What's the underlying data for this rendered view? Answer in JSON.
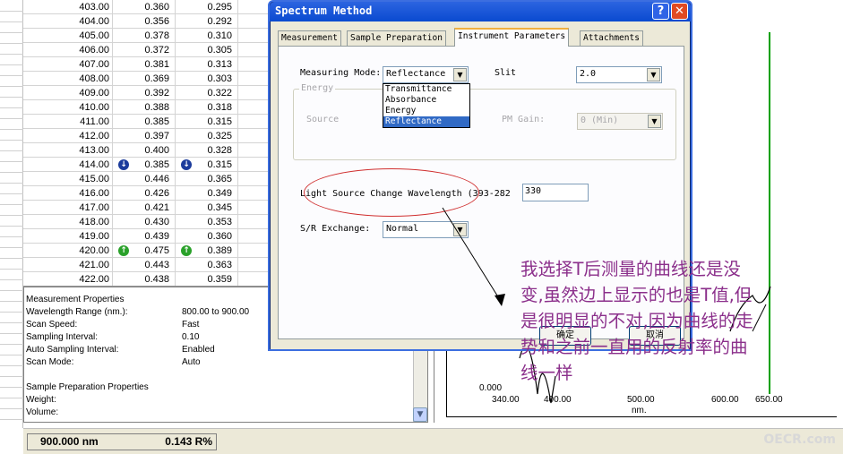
{
  "table": {
    "rows": [
      {
        "wl": "403.00",
        "a": "0.360",
        "b": "0.295",
        "marker": ""
      },
      {
        "wl": "404.00",
        "a": "0.356",
        "b": "0.292",
        "marker": ""
      },
      {
        "wl": "405.00",
        "a": "0.378",
        "b": "0.310",
        "marker": ""
      },
      {
        "wl": "406.00",
        "a": "0.372",
        "b": "0.305",
        "marker": ""
      },
      {
        "wl": "407.00",
        "a": "0.381",
        "b": "0.313",
        "marker": ""
      },
      {
        "wl": "408.00",
        "a": "0.369",
        "b": "0.303",
        "marker": ""
      },
      {
        "wl": "409.00",
        "a": "0.392",
        "b": "0.322",
        "marker": ""
      },
      {
        "wl": "410.00",
        "a": "0.388",
        "b": "0.318",
        "marker": ""
      },
      {
        "wl": "411.00",
        "a": "0.385",
        "b": "0.315",
        "marker": ""
      },
      {
        "wl": "412.00",
        "a": "0.397",
        "b": "0.325",
        "marker": ""
      },
      {
        "wl": "413.00",
        "a": "0.400",
        "b": "0.328",
        "marker": ""
      },
      {
        "wl": "414.00",
        "a": "0.385",
        "b": "0.315",
        "marker": "down"
      },
      {
        "wl": "415.00",
        "a": "0.446",
        "b": "0.365",
        "marker": ""
      },
      {
        "wl": "416.00",
        "a": "0.426",
        "b": "0.349",
        "marker": ""
      },
      {
        "wl": "417.00",
        "a": "0.421",
        "b": "0.345",
        "marker": ""
      },
      {
        "wl": "418.00",
        "a": "0.430",
        "b": "0.353",
        "marker": ""
      },
      {
        "wl": "419.00",
        "a": "0.439",
        "b": "0.360",
        "marker": ""
      },
      {
        "wl": "420.00",
        "a": "0.475",
        "b": "0.389",
        "marker": "up"
      },
      {
        "wl": "421.00",
        "a": "0.443",
        "b": "0.363",
        "marker": ""
      },
      {
        "wl": "422.00",
        "a": "0.438",
        "b": "0.359",
        "marker": ""
      }
    ],
    "marker_icons": {
      "down": "↓",
      "up": "↑"
    }
  },
  "properties": {
    "measurement_header": "Measurement Properties",
    "wavelength_range_label": "Wavelength Range (nm.):",
    "wavelength_range_value": "800.00 to 900.00",
    "scan_speed_label": "Scan Speed:",
    "scan_speed_value": "Fast",
    "sampling_interval_label": "Sampling Interval:",
    "sampling_interval_value": "0.10",
    "auto_sampling_label": "Auto Sampling Interval:",
    "auto_sampling_value": "Enabled",
    "scan_mode_label": "Scan Mode:",
    "scan_mode_value": "Auto",
    "sample_prep_header": "Sample Preparation Properties",
    "weight_label": "Weight:",
    "volume_label": "Volume:"
  },
  "graph": {
    "y_tick": "0.000",
    "x_ticks": [
      "340.00",
      "400.00",
      "500.00",
      "600.00",
      "650.00"
    ],
    "x_unit": "nm."
  },
  "status": {
    "wavelength": "900.000 nm",
    "value": "0.143 R%",
    "watermark": "OECR.com"
  },
  "dialog": {
    "title": "Spectrum Method",
    "help": "?",
    "close": "✕",
    "tabs": [
      "Measurement",
      "Sample Preparation",
      "Instrument Parameters",
      "Attachments"
    ],
    "active_tab": 2,
    "measuring_mode_label": "Measuring Mode:",
    "measuring_mode_value": "Reflectance",
    "measuring_mode_options": [
      "Transmittance",
      "Absorbance",
      "Energy",
      "Reflectance"
    ],
    "slit_label": "Slit",
    "slit_value": "2.0",
    "energy_legend": "Energy",
    "source_label": "Source",
    "pm_gain_label": "PM Gain:",
    "pm_gain_value": "0 (Min)",
    "light_source_label": "Light Source Change Wavelength (393-282",
    "light_source_value": "330",
    "sr_exchange_label": "S/R Exchange:",
    "sr_exchange_value": "Normal",
    "ok_label": "确定",
    "cancel_label": "取消"
  },
  "annotation": {
    "note": "我选择T后测量的曲线还是没变,虽然边上显示的也是T值,但是很明显的不对,因为曲线的走势和之前一直用的反射率的曲线一样",
    "color": "#8b2f8b"
  }
}
